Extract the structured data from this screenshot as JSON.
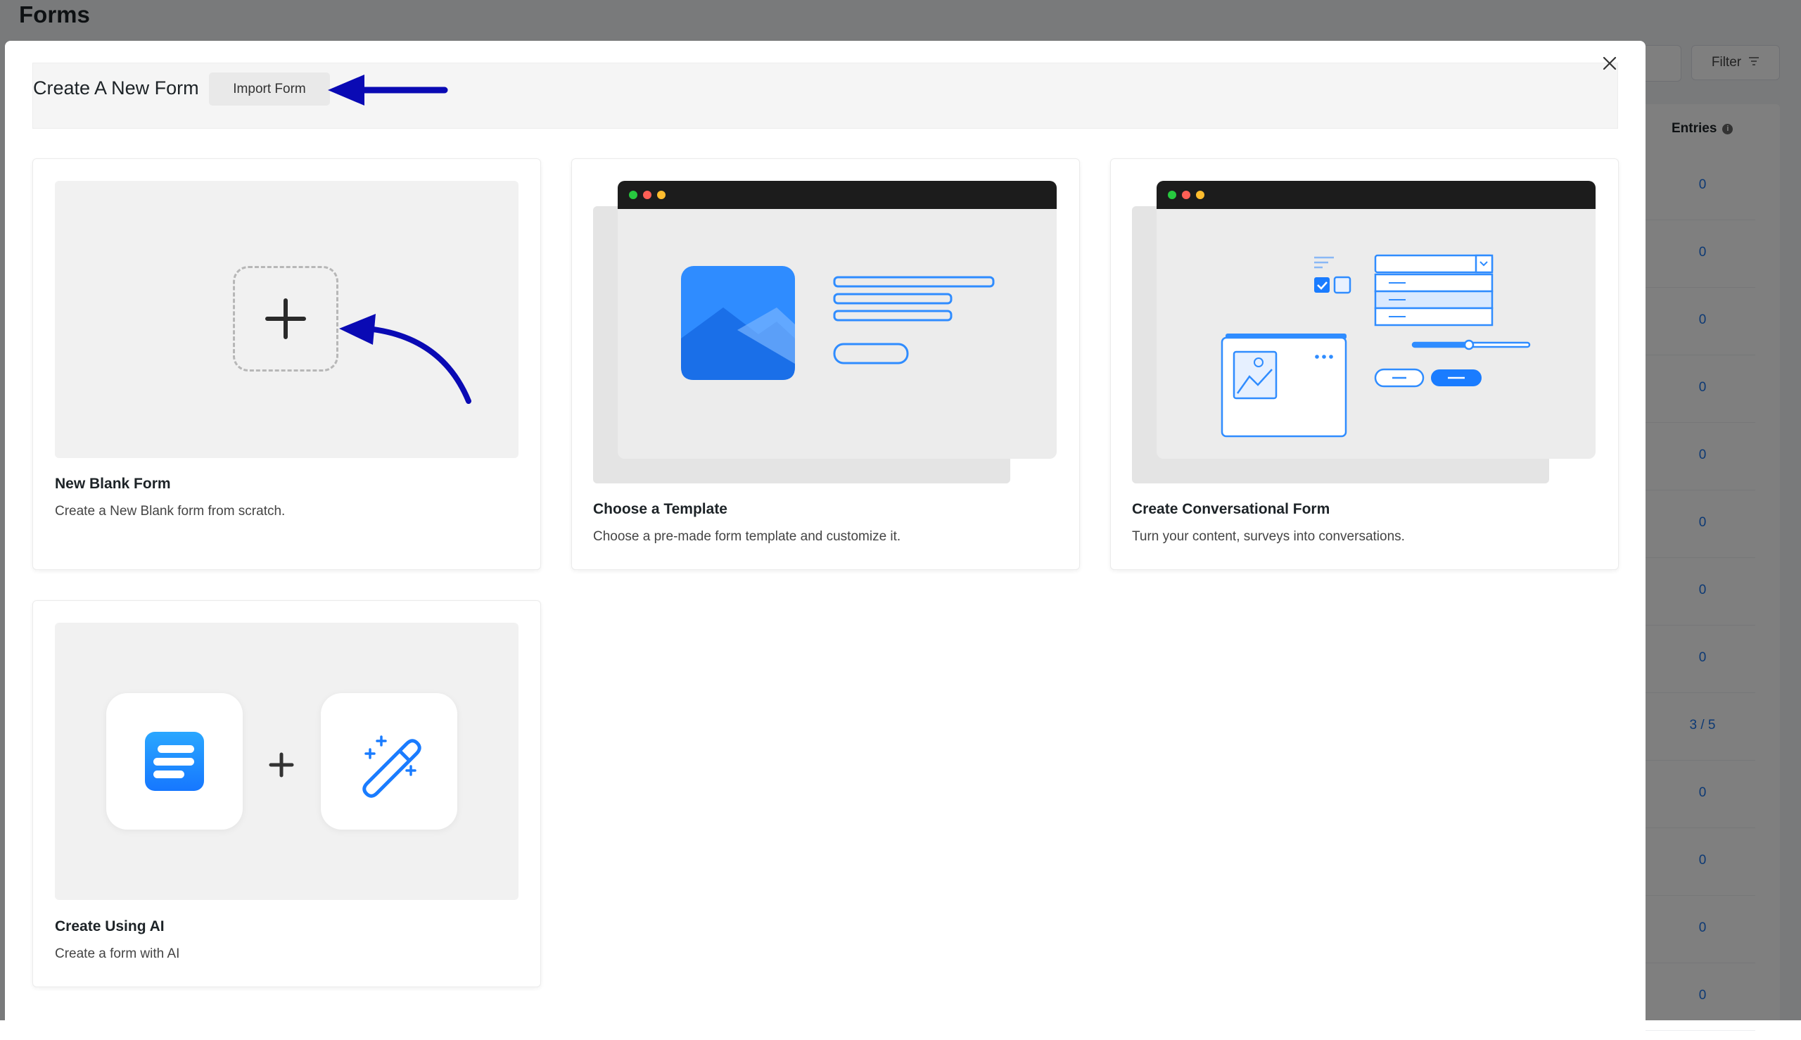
{
  "background_page": {
    "title": "Forms",
    "filter_label": "Filter",
    "entries_header": "Entries",
    "entries_values": [
      "0",
      "0",
      "0",
      "0",
      "0",
      "0",
      "0",
      "0",
      "3 / 5",
      "0",
      "0",
      "0",
      "0"
    ]
  },
  "modal": {
    "title": "Create A New Form",
    "import_button": "Import Form",
    "cards": [
      {
        "title": "New Blank Form",
        "description": "Create a New Blank form from scratch."
      },
      {
        "title": "Choose a Template",
        "description": "Choose a pre-made form template and customize it."
      },
      {
        "title": "Create Conversational Form",
        "description": "Turn your content, surveys into conversations."
      },
      {
        "title": "Create Using AI",
        "description": "Create a form with AI"
      }
    ]
  },
  "icons": [
    "close-icon",
    "plus-icon",
    "filter-icon",
    "info-icon",
    "image-placeholder-icon",
    "fluent-forms-logo-icon",
    "magic-wand-icon",
    "checkbox-icon",
    "dropdown-chevron-icon"
  ],
  "colors": {
    "accent_blue": "#1a7cff",
    "annotation_arrow": "#0a0ab4",
    "entries_link": "#1a73e8"
  }
}
